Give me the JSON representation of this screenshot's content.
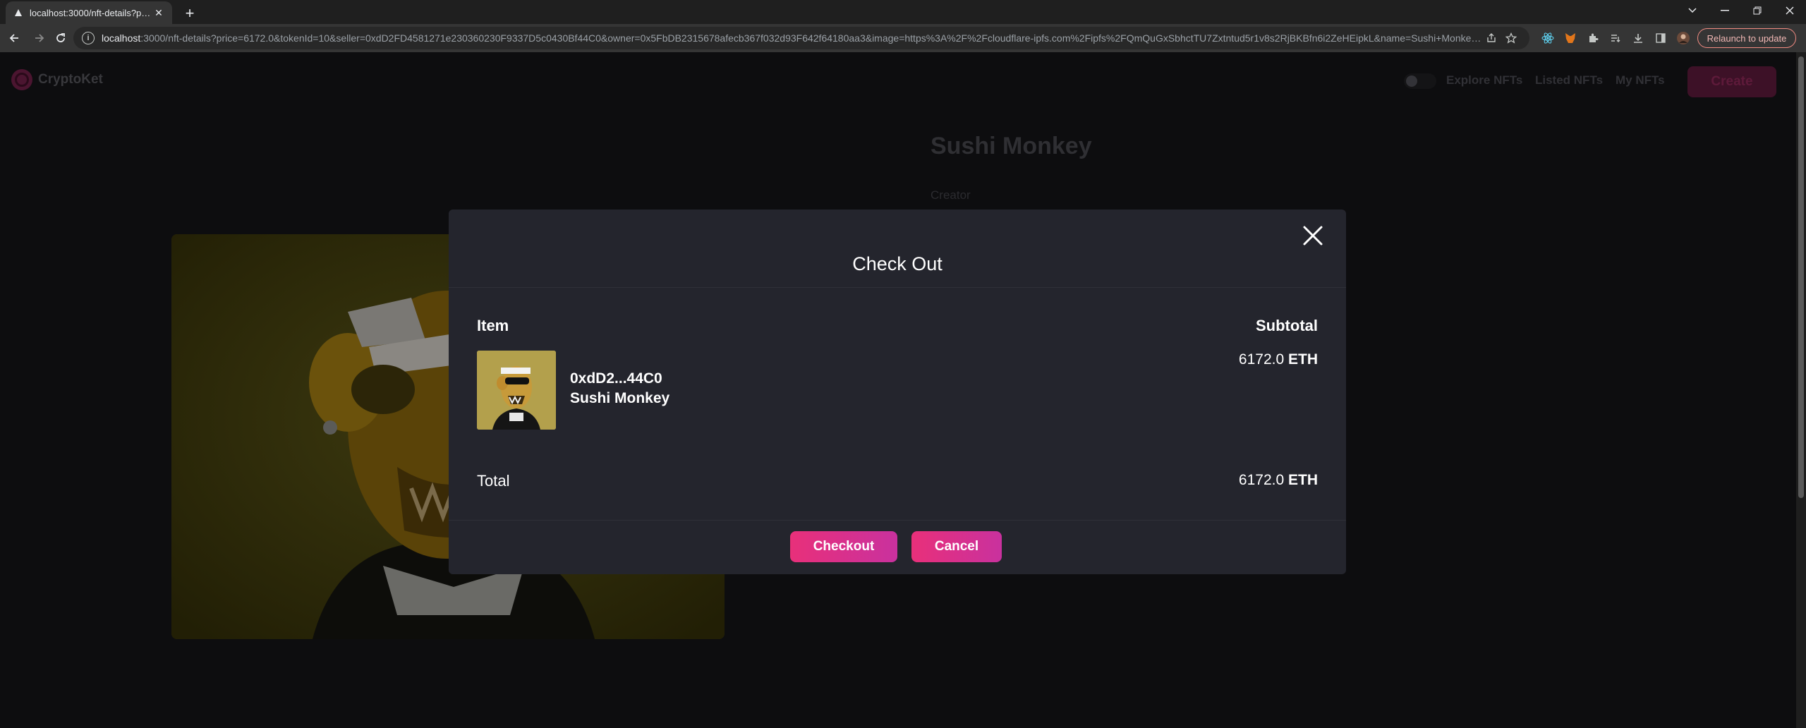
{
  "browser": {
    "tab_title": "localhost:3000/nft-details?price=",
    "url_host": "localhost",
    "url_rest": ":3000/nft-details?price=6172.0&tokenId=10&seller=0xdD2FD4581271e230360230F9337D5c0430Bf44C0&owner=0x5FbDB2315678afecb367f032d93F642f64180aa3&image=https%3A%2F%2Fcloudflare-ipfs.com%2Fipfs%2FQmQuGxSbhctTU7Zxtntud5r1v8s2RjBKBfn6i2ZeHEipkL&name=Sushi+Monkey&desc...",
    "relaunch_label": "Relaunch to update"
  },
  "site": {
    "logo_text": "CryptoKet",
    "nav_links": [
      "Explore NFTs",
      "Listed NFTs",
      "My NFTs"
    ],
    "create_label": "Create",
    "nft_title": "Sushi Monkey",
    "creator_label": "Creator"
  },
  "modal": {
    "title": "Check Out",
    "item_header": "Item",
    "subtotal_header": "Subtotal",
    "item_seller": "0xdD2...44C0",
    "item_name": "Sushi Monkey",
    "subtotal_amount": "6172.0",
    "currency": "ETH",
    "total_label": "Total",
    "total_amount": "6172.0",
    "checkout_label": "Checkout",
    "cancel_label": "Cancel"
  }
}
